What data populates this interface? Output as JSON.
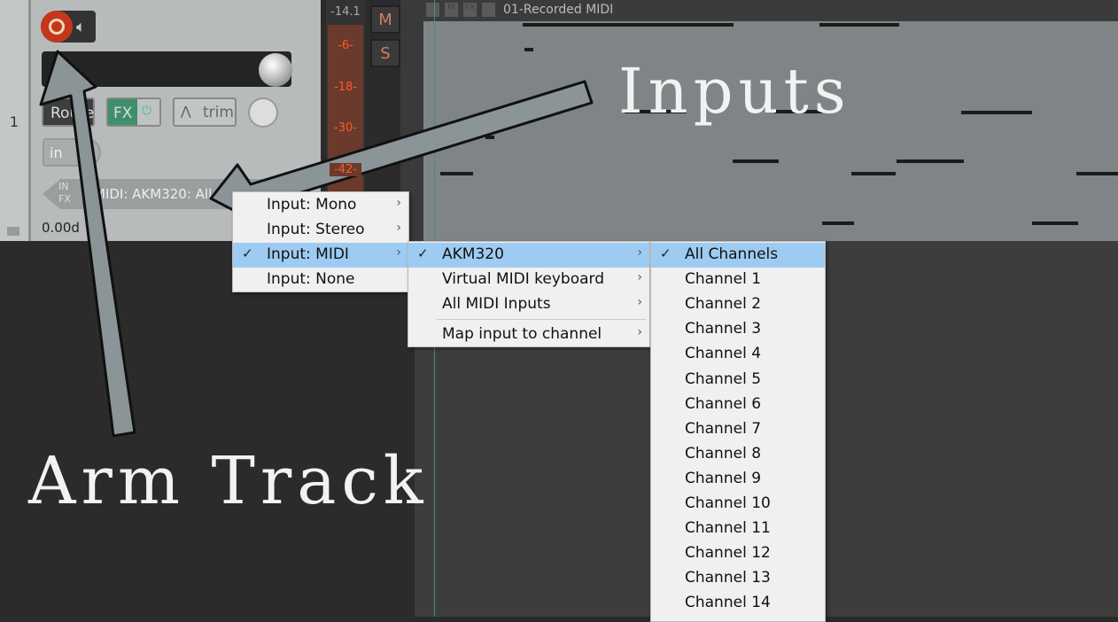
{
  "track": {
    "number": "1",
    "input_label": "MIDI: AKM320: All",
    "input_prefix": [
      "IN",
      "FX"
    ],
    "volume": "0.00d",
    "route_label": "Route",
    "fx_label": "FX",
    "trim_label": "trim",
    "in_label": "in",
    "meter_peak": "-14.1",
    "meter_ticks": [
      "-6-",
      "-18-",
      "-30-",
      "-42-"
    ],
    "mute_label": "M",
    "solo_label": "S"
  },
  "item": {
    "title": "01-Recorded MIDI",
    "header_icons": [
      "lock-icon",
      "M",
      "FX",
      "envelope-icon"
    ]
  },
  "menu1": {
    "items": [
      {
        "label": "Input: Mono",
        "checked": false,
        "submenu": true
      },
      {
        "label": "Input: Stereo",
        "checked": false,
        "submenu": true
      },
      {
        "label": "Input: MIDI",
        "checked": true,
        "submenu": true
      },
      {
        "label": "Input: None",
        "checked": false,
        "submenu": false
      }
    ]
  },
  "menu2": {
    "items": [
      {
        "label": "AKM320",
        "checked": true,
        "submenu": true
      },
      {
        "label": "Virtual MIDI keyboard",
        "submenu": true
      },
      {
        "label": "All MIDI Inputs",
        "submenu": true
      },
      {
        "label": "Map input to channel",
        "submenu": true
      }
    ]
  },
  "menu3": {
    "items": [
      "All Channels",
      "Channel 1",
      "Channel 2",
      "Channel 3",
      "Channel 4",
      "Channel 5",
      "Channel 6",
      "Channel 7",
      "Channel 8",
      "Channel 9",
      "Channel 10",
      "Channel 11",
      "Channel 12",
      "Channel 13",
      "Channel 14"
    ],
    "checked_index": 0
  },
  "annotations": {
    "inputs": "Inputs",
    "arm_track": "Arm Track"
  },
  "colors": {
    "highlight": "#9ecbf1",
    "record": "#c5371c",
    "fx": "#3f8f6c",
    "meter_text": "#ff5a2a"
  }
}
